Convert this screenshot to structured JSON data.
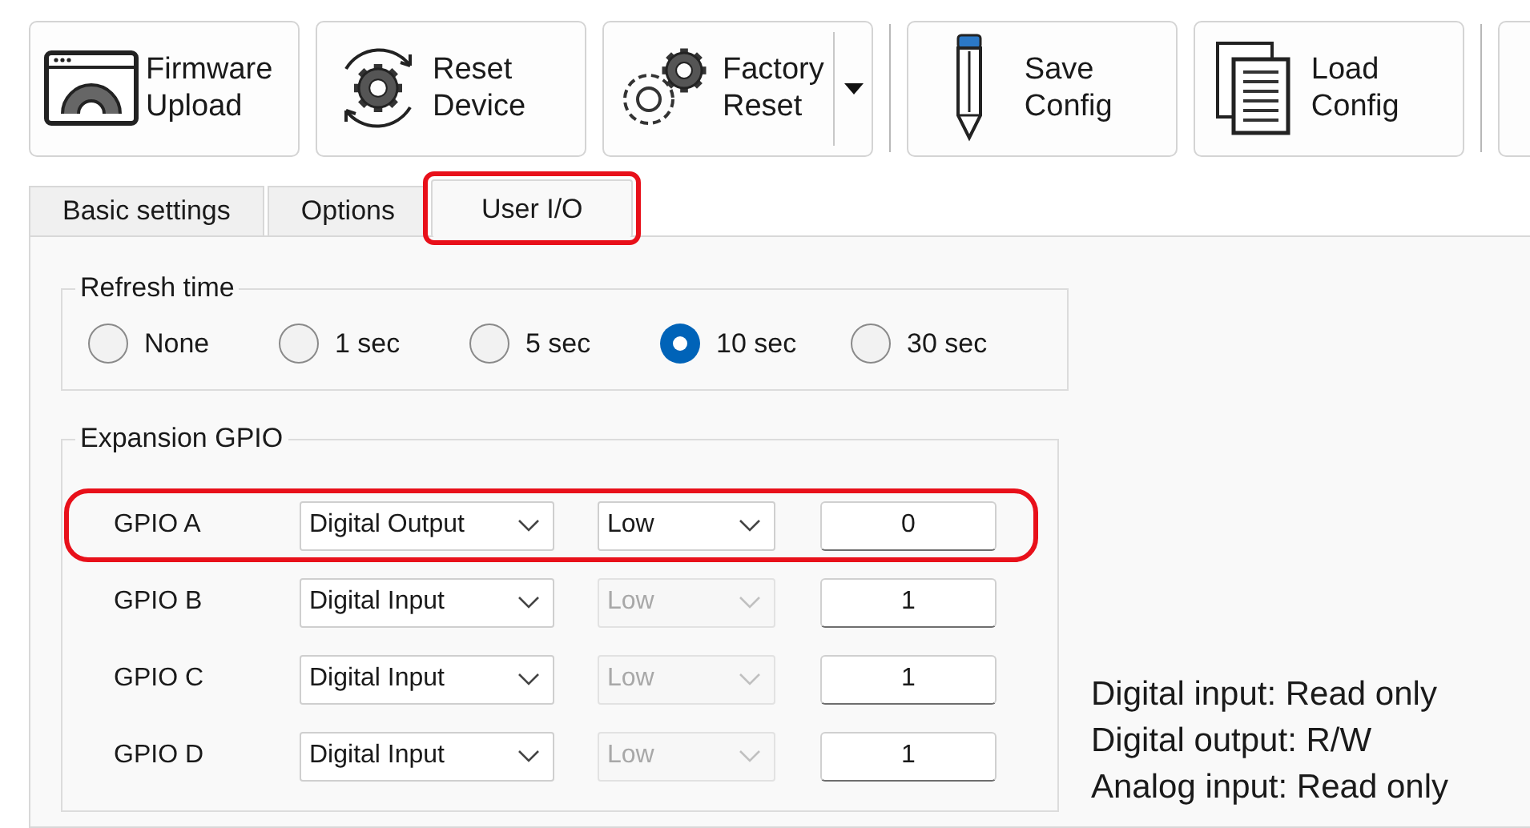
{
  "toolbar": {
    "buttons": [
      {
        "kind": "firmware",
        "lines": [
          "Firmware",
          "Upload"
        ],
        "dropdown": false,
        "separator_before": false
      },
      {
        "kind": "reset",
        "lines": [
          "Reset",
          "Device"
        ],
        "dropdown": false,
        "separator_before": false
      },
      {
        "kind": "factory",
        "lines": [
          "Factory",
          "Reset"
        ],
        "dropdown": true,
        "separator_before": false
      },
      {
        "kind": "save",
        "lines": [
          "Save",
          "Config"
        ],
        "dropdown": false,
        "separator_before": true
      },
      {
        "kind": "load",
        "lines": [
          "Load",
          "Config"
        ],
        "dropdown": false,
        "separator_before": false
      }
    ]
  },
  "tabs": [
    {
      "label": "Basic settings",
      "selected": false,
      "highlighted": false
    },
    {
      "label": "Options",
      "selected": false,
      "highlighted": false
    },
    {
      "label": "User I/O",
      "selected": true,
      "highlighted": true
    }
  ],
  "refresh_time": {
    "title": "Refresh time",
    "options": [
      {
        "label": "None",
        "selected": false
      },
      {
        "label": "1 sec",
        "selected": false
      },
      {
        "label": "5 sec",
        "selected": false
      },
      {
        "label": "10 sec",
        "selected": true
      },
      {
        "label": "30 sec",
        "selected": false
      }
    ]
  },
  "expansion_gpio": {
    "title": "Expansion GPIO",
    "rows": [
      {
        "name": "GPIO A",
        "mode": "Digital Output",
        "level": "Low",
        "level_disabled": false,
        "value": "0",
        "highlighted": true
      },
      {
        "name": "GPIO B",
        "mode": "Digital Input",
        "level": "Low",
        "level_disabled": true,
        "value": "1",
        "highlighted": false
      },
      {
        "name": "GPIO C",
        "mode": "Digital Input",
        "level": "Low",
        "level_disabled": true,
        "value": "1",
        "highlighted": false
      },
      {
        "name": "GPIO D",
        "mode": "Digital Input",
        "level": "Low",
        "level_disabled": true,
        "value": "1",
        "highlighted": false
      }
    ]
  },
  "help_lines": [
    "Digital input: Read only",
    "Digital output: R/W",
    "Analog input: Read only"
  ]
}
